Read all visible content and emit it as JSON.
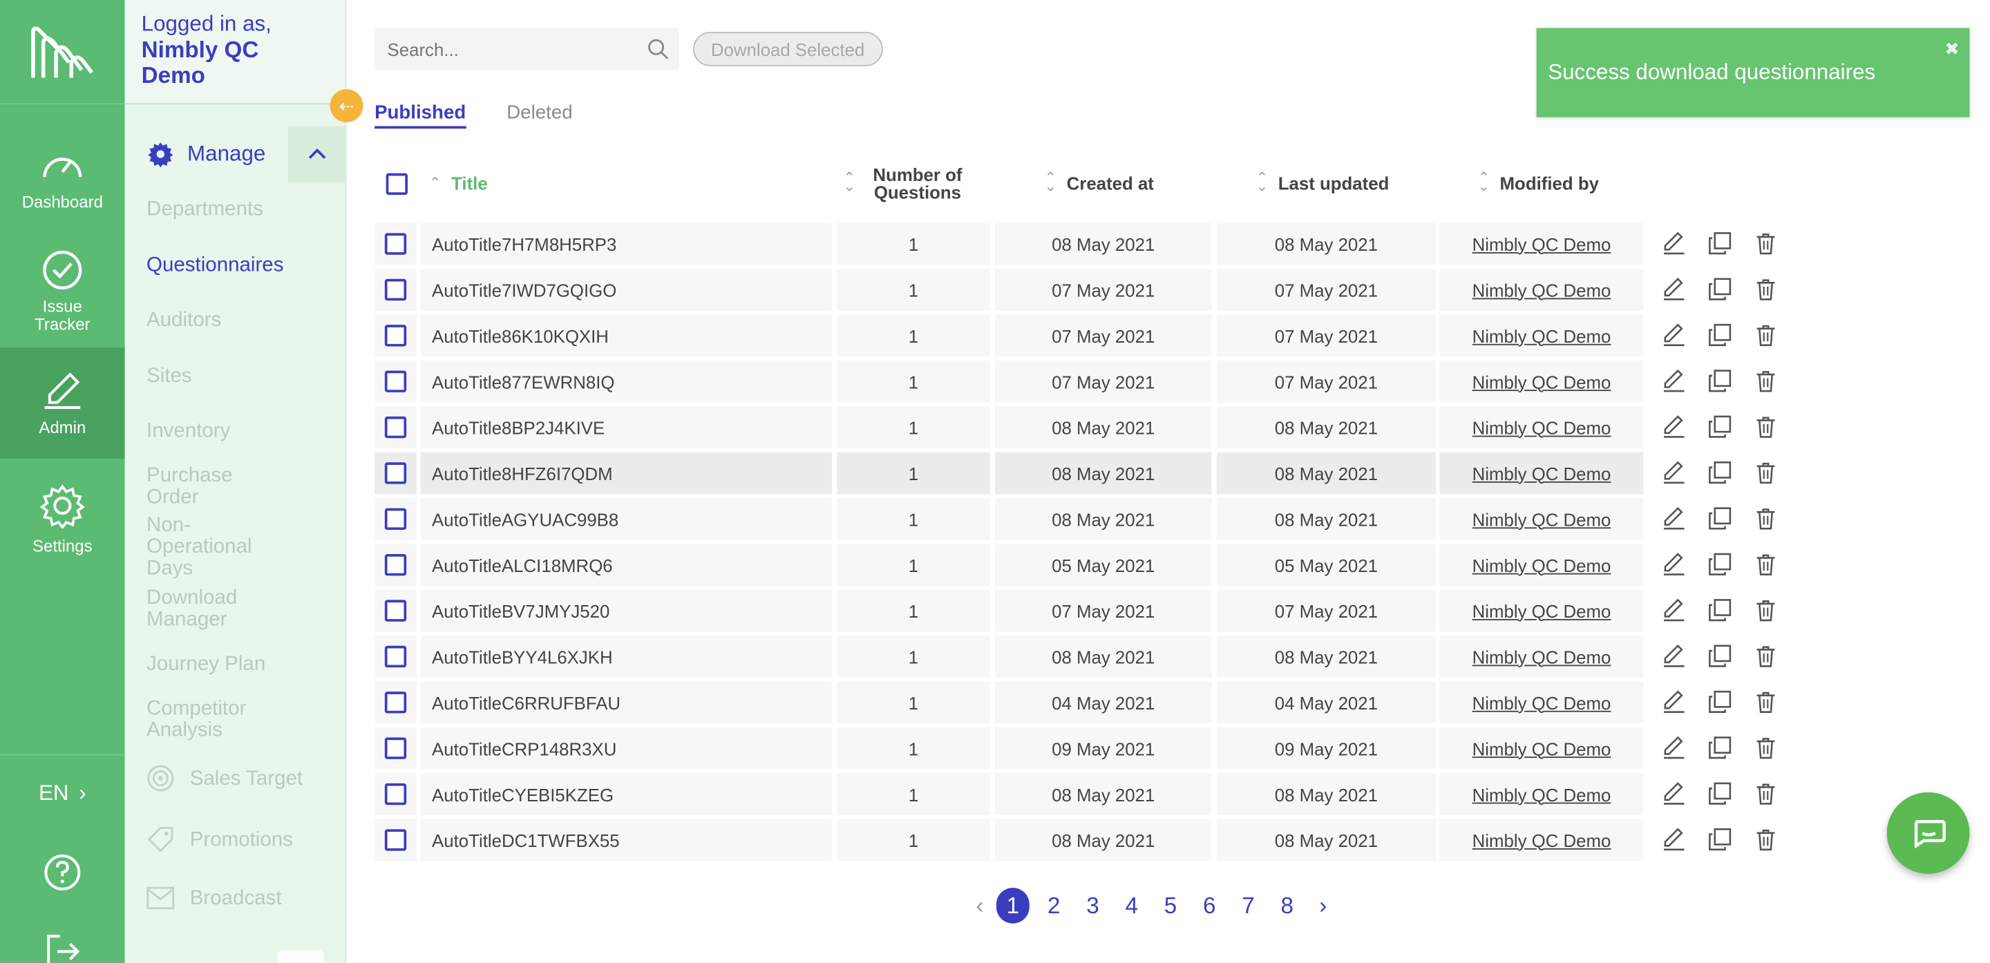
{
  "user": {
    "logged_in_label": "Logged in as,",
    "name": "Nimbly QC Demo"
  },
  "rail": {
    "items": [
      {
        "label": "Dashboard",
        "icon": "dashboard-icon"
      },
      {
        "label": "Issue Tracker",
        "icon": "issue-tracker-icon"
      },
      {
        "label": "Admin",
        "icon": "admin-icon"
      },
      {
        "label": "Settings",
        "icon": "settings-icon"
      }
    ],
    "language": "EN",
    "active": "Admin"
  },
  "sidebar": {
    "section": "Manage",
    "links": [
      "Departments",
      "Questionnaires",
      "Auditors",
      "Sites",
      "Inventory",
      "Purchase Order",
      "Non-Operational Days",
      "Download Manager",
      "Journey Plan",
      "Competitor Analysis"
    ],
    "icon_links": [
      "Sales Target",
      "Promotions",
      "Broadcast"
    ],
    "active": "Questionnaires"
  },
  "toolbar": {
    "search_placeholder": "Search...",
    "download_selected": "Download Selected"
  },
  "tabs": [
    "Published",
    "Deleted"
  ],
  "table": {
    "headers": {
      "title": "Title",
      "num_questions": "Number of Questions",
      "created": "Created at",
      "updated": "Last updated",
      "modified": "Modified by"
    },
    "rows": [
      {
        "title": "AutoTitle7H7M8H5RP3",
        "num": "1",
        "created": "08 May 2021",
        "updated": "08 May 2021",
        "modified": "Nimbly QC Demo"
      },
      {
        "title": "AutoTitle7IWD7GQIGO",
        "num": "1",
        "created": "07 May 2021",
        "updated": "07 May 2021",
        "modified": "Nimbly QC Demo"
      },
      {
        "title": "AutoTitle86K10KQXIH",
        "num": "1",
        "created": "07 May 2021",
        "updated": "07 May 2021",
        "modified": "Nimbly QC Demo"
      },
      {
        "title": "AutoTitle877EWRN8IQ",
        "num": "1",
        "created": "07 May 2021",
        "updated": "07 May 2021",
        "modified": "Nimbly QC Demo"
      },
      {
        "title": "AutoTitle8BP2J4KIVE",
        "num": "1",
        "created": "08 May 2021",
        "updated": "08 May 2021",
        "modified": "Nimbly QC Demo"
      },
      {
        "title": "AutoTitle8HFZ6I7QDM",
        "num": "1",
        "created": "08 May 2021",
        "updated": "08 May 2021",
        "modified": "Nimbly QC Demo"
      },
      {
        "title": "AutoTitleAGYUAC99B8",
        "num": "1",
        "created": "08 May 2021",
        "updated": "08 May 2021",
        "modified": "Nimbly QC Demo"
      },
      {
        "title": "AutoTitleALCI18MRQ6",
        "num": "1",
        "created": "05 May 2021",
        "updated": "05 May 2021",
        "modified": "Nimbly QC Demo"
      },
      {
        "title": "AutoTitleBV7JMYJ520",
        "num": "1",
        "created": "07 May 2021",
        "updated": "07 May 2021",
        "modified": "Nimbly QC Demo"
      },
      {
        "title": "AutoTitleBYY4L6XJKH",
        "num": "1",
        "created": "08 May 2021",
        "updated": "08 May 2021",
        "modified": "Nimbly QC Demo"
      },
      {
        "title": "AutoTitleC6RRUFBFAU",
        "num": "1",
        "created": "04 May 2021",
        "updated": "04 May 2021",
        "modified": "Nimbly QC Demo"
      },
      {
        "title": "AutoTitleCRP148R3XU",
        "num": "1",
        "created": "09 May 2021",
        "updated": "09 May 2021",
        "modified": "Nimbly QC Demo"
      },
      {
        "title": "AutoTitleCYEBI5KZEG",
        "num": "1",
        "created": "08 May 2021",
        "updated": "08 May 2021",
        "modified": "Nimbly QC Demo"
      },
      {
        "title": "AutoTitleDC1TWFBX55",
        "num": "1",
        "created": "08 May 2021",
        "updated": "08 May 2021",
        "modified": "Nimbly QC Demo"
      }
    ],
    "highlighted_row": 5
  },
  "pagination": {
    "pages": [
      "1",
      "2",
      "3",
      "4",
      "5",
      "6",
      "7",
      "8"
    ],
    "current": "1"
  },
  "toast": {
    "message": "Success download questionnaires",
    "close": "✖"
  },
  "colors": {
    "brand_green": "#5bbb72",
    "accent_indigo": "#3b3dbf",
    "toast_green": "#67c46f",
    "collapse_orange": "#f5b43a"
  }
}
